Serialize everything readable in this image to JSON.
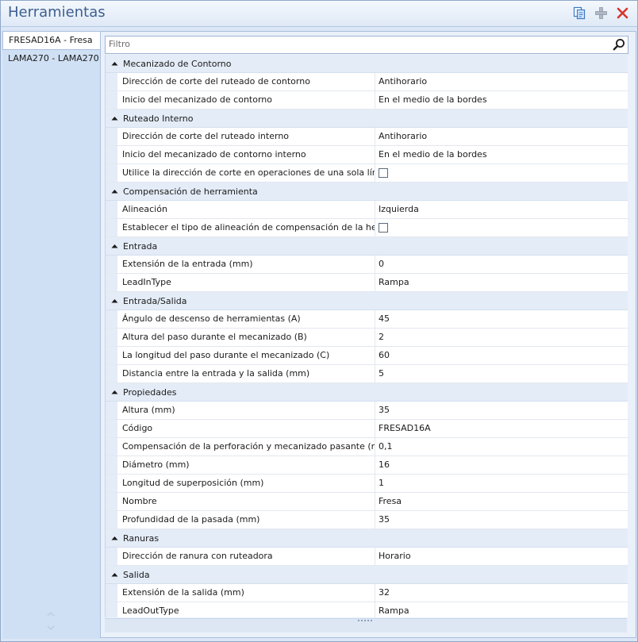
{
  "window": {
    "title": "Herramientas"
  },
  "toolbar": {
    "icons": [
      "copy-icon",
      "add-icon",
      "delete-icon"
    ],
    "colors": {
      "copy": "#3a78c6",
      "add": "#9aa6b4",
      "delete": "#d9342b"
    }
  },
  "sidebar": {
    "items": [
      {
        "label": "FRESAD16A - Fresa",
        "active": true
      },
      {
        "label": "LAMA270 - LAMA270",
        "active": false
      }
    ]
  },
  "filter": {
    "placeholder": "Filtro",
    "value": ""
  },
  "categories": [
    {
      "label": "Mecanizado de Contorno",
      "rows": [
        {
          "name": "Dirección de corte del ruteado de contorno",
          "value": "Antihorario"
        },
        {
          "name": "Inicio del mecanizado de contorno",
          "value": "En el medio de la bordes"
        }
      ]
    },
    {
      "label": "Ruteado Interno",
      "rows": [
        {
          "name": "Dirección de corte del ruteado interno",
          "value": "Antihorario"
        },
        {
          "name": "Inicio del mecanizado de contorno interno",
          "value": "En el medio de la bordes"
        },
        {
          "name": "Utilice la dirección de corte en operaciones de una sola línea",
          "value": "",
          "checkbox": true,
          "checked": false
        }
      ]
    },
    {
      "label": "Compensación de herramienta",
      "rows": [
        {
          "name": "Alineación",
          "value": "Izquierda"
        },
        {
          "name": "Establecer el tipo de alineación de compensación de la herra...",
          "value": "",
          "checkbox": true,
          "checked": false
        }
      ]
    },
    {
      "label": "Entrada",
      "rows": [
        {
          "name": "Extensión de la entrada (mm)",
          "value": "0"
        },
        {
          "name": "LeadInType",
          "value": "Rampa"
        }
      ]
    },
    {
      "label": "Entrada/Salida",
      "rows": [
        {
          "name": "Ángulo de descenso de herramientas (A)",
          "value": "45"
        },
        {
          "name": "Altura del paso durante el mecanizado (B)",
          "value": "2"
        },
        {
          "name": "La longitud del paso durante el mecanizado (C)",
          "value": "60"
        },
        {
          "name": "Distancia entre la entrada y la salida (mm)",
          "value": "5"
        }
      ]
    },
    {
      "label": "Propiedades",
      "rows": [
        {
          "name": "Altura (mm)",
          "value": "35"
        },
        {
          "name": "Código",
          "value": "FRESAD16A"
        },
        {
          "name": "Compensación de la perforación y mecanizado pasante (mm)",
          "value": "0,1"
        },
        {
          "name": "Diámetro (mm)",
          "value": "16"
        },
        {
          "name": "Longitud de superposición (mm)",
          "value": "1"
        },
        {
          "name": "Nombre",
          "value": "Fresa"
        },
        {
          "name": "Profundidad de la pasada (mm)",
          "value": "35"
        }
      ]
    },
    {
      "label": "Ranuras",
      "rows": [
        {
          "name": "Dirección de ranura con ruteadora",
          "value": "Horario"
        }
      ]
    },
    {
      "label": "Salida",
      "rows": [
        {
          "name": "Extensión de la salida (mm)",
          "value": "32"
        },
        {
          "name": "LeadOutType",
          "value": "Rampa"
        }
      ]
    }
  ]
}
